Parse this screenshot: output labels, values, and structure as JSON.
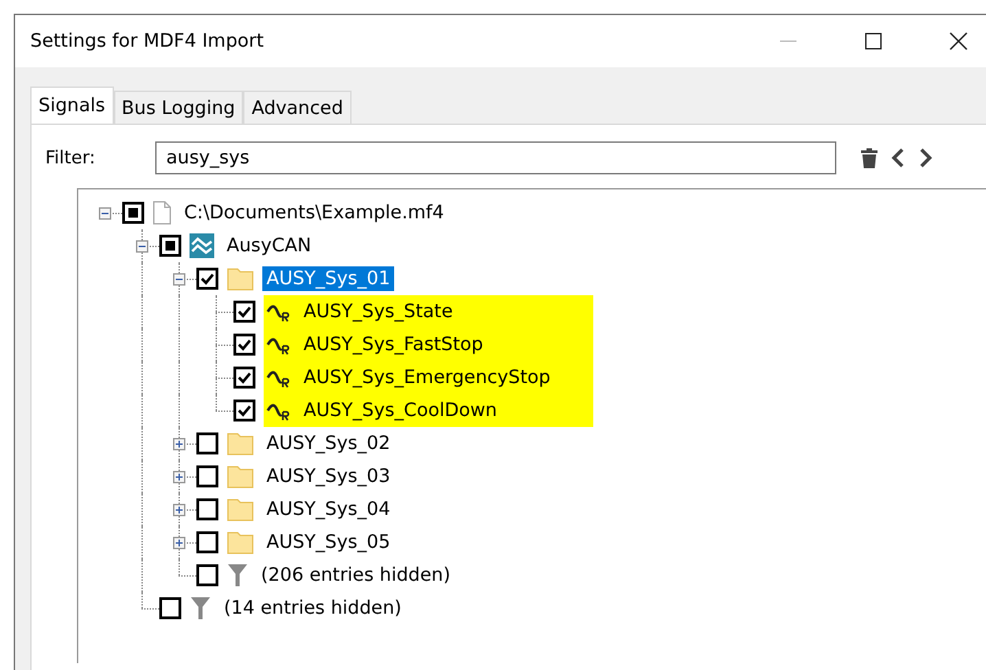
{
  "window": {
    "title": "Settings for MDF4 Import"
  },
  "tabs": [
    {
      "label": "Signals",
      "selected": true
    },
    {
      "label": "Bus Logging",
      "selected": false
    },
    {
      "label": "Advanced",
      "selected": false
    }
  ],
  "filter": {
    "label": "Filter:",
    "value": "ausy_sys"
  },
  "tree": [
    {
      "kind": "file",
      "label": "C:\\Documents\\Example.mf4",
      "checked": false,
      "indeterminate": true,
      "expanded": true,
      "selected": false,
      "highlighted": false,
      "children": [
        {
          "kind": "bus",
          "label": "AusyCAN",
          "checked": false,
          "indeterminate": true,
          "expanded": true,
          "selected": false,
          "highlighted": false,
          "children": [
            {
              "kind": "folder",
              "label": "AUSY_Sys_01",
              "checked": true,
              "indeterminate": false,
              "expanded": true,
              "selected": true,
              "highlighted": false,
              "children": [
                {
                  "kind": "signal",
                  "label": "AUSY_Sys_State",
                  "checked": true,
                  "indeterminate": false,
                  "selected": false,
                  "highlighted": true
                },
                {
                  "kind": "signal",
                  "label": "AUSY_Sys_FastStop",
                  "checked": true,
                  "indeterminate": false,
                  "selected": false,
                  "highlighted": true
                },
                {
                  "kind": "signal",
                  "label": "AUSY_Sys_EmergencyStop",
                  "checked": true,
                  "indeterminate": false,
                  "selected": false,
                  "highlighted": true
                },
                {
                  "kind": "signal",
                  "label": "AUSY_Sys_CoolDown",
                  "checked": true,
                  "indeterminate": false,
                  "selected": false,
                  "highlighted": true
                }
              ]
            },
            {
              "kind": "folder",
              "label": "AUSY_Sys_02",
              "checked": false,
              "indeterminate": false,
              "expanded": false,
              "selected": false,
              "highlighted": false
            },
            {
              "kind": "folder",
              "label": "AUSY_Sys_03",
              "checked": false,
              "indeterminate": false,
              "expanded": false,
              "selected": false,
              "highlighted": false
            },
            {
              "kind": "folder",
              "label": "AUSY_Sys_04",
              "checked": false,
              "indeterminate": false,
              "expanded": false,
              "selected": false,
              "highlighted": false
            },
            {
              "kind": "folder",
              "label": "AUSY_Sys_05",
              "checked": false,
              "indeterminate": false,
              "expanded": false,
              "selected": false,
              "highlighted": false
            },
            {
              "kind": "hidden",
              "label": "(206 entries hidden)",
              "checked": false,
              "indeterminate": false,
              "selected": false,
              "highlighted": false
            }
          ]
        },
        {
          "kind": "hidden",
          "label": "(14 entries hidden)",
          "checked": false,
          "indeterminate": false,
          "selected": false,
          "highlighted": false
        }
      ]
    }
  ]
}
